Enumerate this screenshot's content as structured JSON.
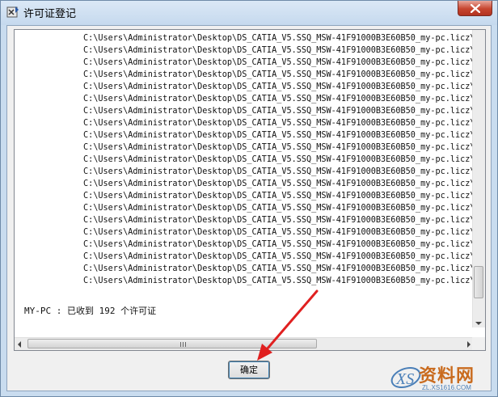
{
  "window": {
    "title": "许可证登记"
  },
  "icons": {
    "app": "license-app-icon",
    "close": "close-icon",
    "annotation": "red-arrow-icon"
  },
  "log": {
    "lines": [
      "C:\\Users\\Administrator\\Desktop\\DS_CATIA_V5.SSQ_MSW-41F91000B3E60B50_my-pc.licz\\SR",
      "C:\\Users\\Administrator\\Desktop\\DS_CATIA_V5.SSQ_MSW-41F91000B3E60B50_my-pc.licz\\SR",
      "C:\\Users\\Administrator\\Desktop\\DS_CATIA_V5.SSQ_MSW-41F91000B3E60B50_my-pc.licz\\SS",
      "C:\\Users\\Administrator\\Desktop\\DS_CATIA_V5.SSQ_MSW-41F91000B3E60B50_my-pc.licz\\ST",
      "C:\\Users\\Administrator\\Desktop\\DS_CATIA_V5.SSQ_MSW-41F91000B3E60B50_my-pc.licz\\ST",
      "C:\\Users\\Administrator\\Desktop\\DS_CATIA_V5.SSQ_MSW-41F91000B3E60B50_my-pc.licz\\ST",
      "C:\\Users\\Administrator\\Desktop\\DS_CATIA_V5.SSQ_MSW-41F91000B3E60B50_my-pc.licz\\SX",
      "C:\\Users\\Administrator\\Desktop\\DS_CATIA_V5.SSQ_MSW-41F91000B3E60B50_my-pc.licz\\TG",
      "C:\\Users\\Administrator\\Desktop\\DS_CATIA_V5.SSQ_MSW-41F91000B3E60B50_my-pc.licz\\TL",
      "C:\\Users\\Administrator\\Desktop\\DS_CATIA_V5.SSQ_MSW-41F91000B3E60B50_my-pc.licz\\TU",
      "C:\\Users\\Administrator\\Desktop\\DS_CATIA_V5.SSQ_MSW-41F91000B3E60B50_my-pc.licz\\TU",
      "C:\\Users\\Administrator\\Desktop\\DS_CATIA_V5.SSQ_MSW-41F91000B3E60B50_my-pc.licz\\VO",
      "C:\\Users\\Administrator\\Desktop\\DS_CATIA_V5.SSQ_MSW-41F91000B3E60B50_my-pc.licz\\WA",
      "C:\\Users\\Administrator\\Desktop\\DS_CATIA_V5.SSQ_MSW-41F91000B3E60B50_my-pc.licz\\WD",
      "C:\\Users\\Administrator\\Desktop\\DS_CATIA_V5.SSQ_MSW-41F91000B3E60B50_my-pc.licz\\WG",
      "C:\\Users\\Administrator\\Desktop\\DS_CATIA_V5.SSQ_MSW-41F91000B3E60B50_my-pc.licz\\WS",
      "C:\\Users\\Administrator\\Desktop\\DS_CATIA_V5.SSQ_MSW-41F91000B3E60B50_my-pc.licz\\XL",
      "C:\\Users\\Administrator\\Desktop\\DS_CATIA_V5.SSQ_MSW-41F91000B3E60B50_my-pc.licz\\XL",
      "C:\\Users\\Administrator\\Desktop\\DS_CATIA_V5.SSQ_MSW-41F91000B3E60B50_my-pc.licz\\XL",
      "C:\\Users\\Administrator\\Desktop\\DS_CATIA_V5.SSQ_MSW-41F91000B3E60B50_my-pc.licz\\XM",
      "C:\\Users\\Administrator\\Desktop\\DS_CATIA_V5.SSQ_MSW-41F91000B3E60B50_my-pc.licz\\YM"
    ],
    "status": "MY-PC : 已收到 192 个许可证"
  },
  "buttons": {
    "ok_label": "确定"
  },
  "watermark": {
    "main": "资料网",
    "sub": "ZL.XS1616.COM",
    "logo_text": "XS"
  },
  "colors": {
    "annotation": "#e02020",
    "watermark_orange": "#c96b1e",
    "watermark_blue": "#4a7fb8"
  }
}
